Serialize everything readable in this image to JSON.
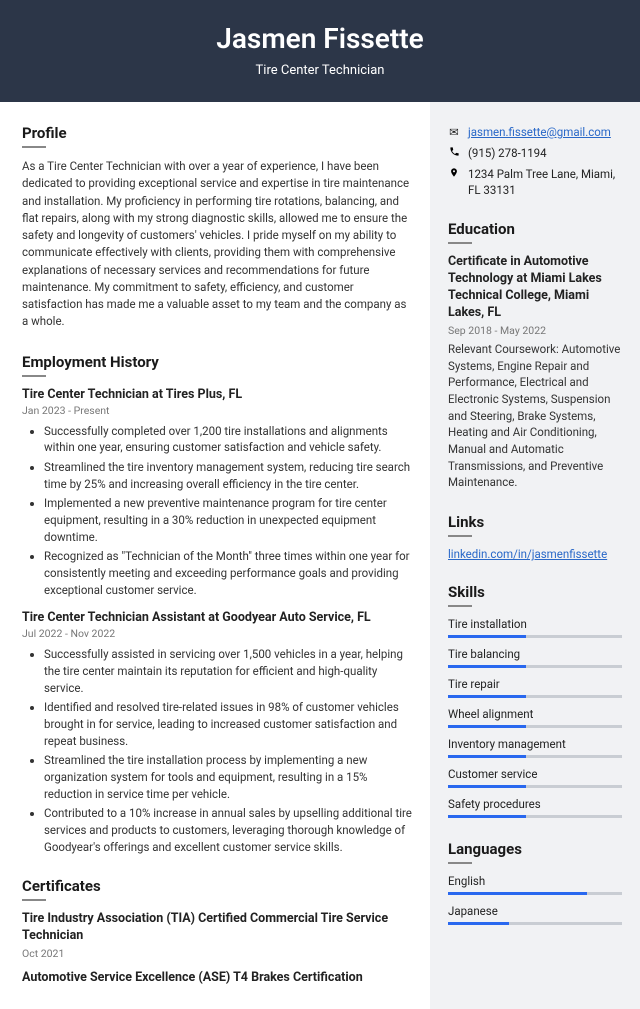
{
  "header": {
    "name": "Jasmen Fissette",
    "title": "Tire Center Technician"
  },
  "profile": {
    "heading": "Profile",
    "text": "As a Tire Center Technician with over a year of experience, I have been dedicated to providing exceptional service and expertise in tire maintenance and installation. My proficiency in performing tire rotations, balancing, and flat repairs, along with my strong diagnostic skills, allowed me to ensure the safety and longevity of customers' vehicles. I pride myself on my ability to communicate effectively with clients, providing them with comprehensive explanations of necessary services and recommendations for future maintenance. My commitment to safety, efficiency, and customer satisfaction has made me a valuable asset to my team and the company as a whole."
  },
  "employment": {
    "heading": "Employment History",
    "jobs": [
      {
        "title": "Tire Center Technician at Tires Plus, FL",
        "dates": "Jan 2023 - Present",
        "bullets": [
          "Successfully completed over 1,200 tire installations and alignments within one year, ensuring customer satisfaction and vehicle safety.",
          "Streamlined the tire inventory management system, reducing tire search time by 25% and increasing overall efficiency in the tire center.",
          "Implemented a new preventive maintenance program for tire center equipment, resulting in a 30% reduction in unexpected equipment downtime.",
          "Recognized as \"Technician of the Month\" three times within one year for consistently meeting and exceeding performance goals and providing exceptional customer service."
        ]
      },
      {
        "title": "Tire Center Technician Assistant at Goodyear Auto Service, FL",
        "dates": "Jul 2022 - Nov 2022",
        "bullets": [
          "Successfully assisted in servicing over 1,500 vehicles in a year, helping the tire center maintain its reputation for efficient and high-quality service.",
          "Identified and resolved tire-related issues in 98% of customer vehicles brought in for service, leading to increased customer satisfaction and repeat business.",
          "Streamlined the tire installation process by implementing a new organization system for tools and equipment, resulting in a 15% reduction in service time per vehicle.",
          "Contributed to a 10% increase in annual sales by upselling additional tire services and products to customers, leveraging thorough knowledge of Goodyear's offerings and excellent customer service skills."
        ]
      }
    ]
  },
  "certificates": {
    "heading": "Certificates",
    "items": [
      {
        "title": "Tire Industry Association (TIA) Certified Commercial Tire Service Technician",
        "date": "Oct 2021"
      },
      {
        "title": "Automotive Service Excellence (ASE) T4 Brakes Certification",
        "date": ""
      }
    ]
  },
  "contact": {
    "email": "jasmen.fissette@gmail.com",
    "phone": "(915) 278-1194",
    "address": "1234 Palm Tree Lane, Miami, FL 33131"
  },
  "education": {
    "heading": "Education",
    "title": "Certificate in Automotive Technology at Miami Lakes Technical College, Miami Lakes, FL",
    "dates": "Sep 2018 - May 2022",
    "desc": "Relevant Coursework: Automotive Systems, Engine Repair and Performance, Electrical and Electronic Systems, Suspension and Steering, Brake Systems, Heating and Air Conditioning, Manual and Automatic Transmissions, and Preventive Maintenance."
  },
  "links": {
    "heading": "Links",
    "items": [
      "linkedin.com/in/jasmenfissette"
    ]
  },
  "skills": {
    "heading": "Skills",
    "items": [
      {
        "name": "Tire installation",
        "level": 45
      },
      {
        "name": "Tire balancing",
        "level": 45
      },
      {
        "name": "Tire repair",
        "level": 45
      },
      {
        "name": "Wheel alignment",
        "level": 45
      },
      {
        "name": "Inventory management",
        "level": 45
      },
      {
        "name": "Customer service",
        "level": 45
      },
      {
        "name": "Safety procedures",
        "level": 45
      }
    ]
  },
  "languages": {
    "heading": "Languages",
    "items": [
      {
        "name": "English",
        "level": 80
      },
      {
        "name": "Japanese",
        "level": 35
      }
    ]
  }
}
